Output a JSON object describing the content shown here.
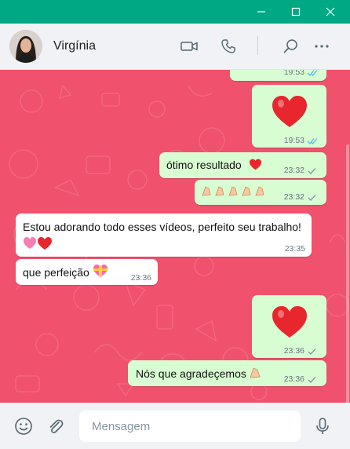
{
  "window": {
    "minimize_glyph": "—",
    "maximize_glyph": "☐",
    "close_glyph": "✕"
  },
  "header": {
    "contact_name": "Virgínia",
    "icons": [
      "video-call-icon",
      "voice-call-icon",
      "search-icon",
      "menu-icon"
    ]
  },
  "messages": [
    {
      "direction": "out",
      "text": "",
      "time": "19:53",
      "status": "read"
    },
    {
      "direction": "out",
      "emoji": "heart",
      "time": "19:53",
      "status": "read"
    },
    {
      "direction": "out",
      "text": "ótimo resultado",
      "emoji": "heart",
      "time": "23:32",
      "status": "sent"
    },
    {
      "direction": "out",
      "emoji": "clapping-hands x5",
      "time": "23:32",
      "status": "sent"
    },
    {
      "direction": "in",
      "text": "Estou adorando todo esses vídeos, perfeito seu trabalho!",
      "emoji": "revolving-hearts, heart",
      "time": "23:35"
    },
    {
      "direction": "in",
      "text": "que perfeição",
      "emoji": "heart-with-ribbon",
      "time": "23:36"
    },
    {
      "direction": "out",
      "emoji": "heart",
      "time": "23:36",
      "status": "sent"
    },
    {
      "direction": "out",
      "text": "Nós que agradeçemos",
      "emoji": "clapping-hands",
      "time": "23:36",
      "status": "sent"
    }
  ],
  "composer": {
    "placeholder": "Mensagem",
    "icons": [
      "emoji-icon",
      "attach-icon",
      "mic-icon"
    ]
  },
  "colors": {
    "titlebar": "#00a884",
    "chat_background": "#f0516d",
    "outgoing_bubble": "#d9fdd3",
    "incoming_bubble": "#ffffff",
    "read_ticks": "#53bdeb",
    "sent_ticks": "#8696a0"
  }
}
